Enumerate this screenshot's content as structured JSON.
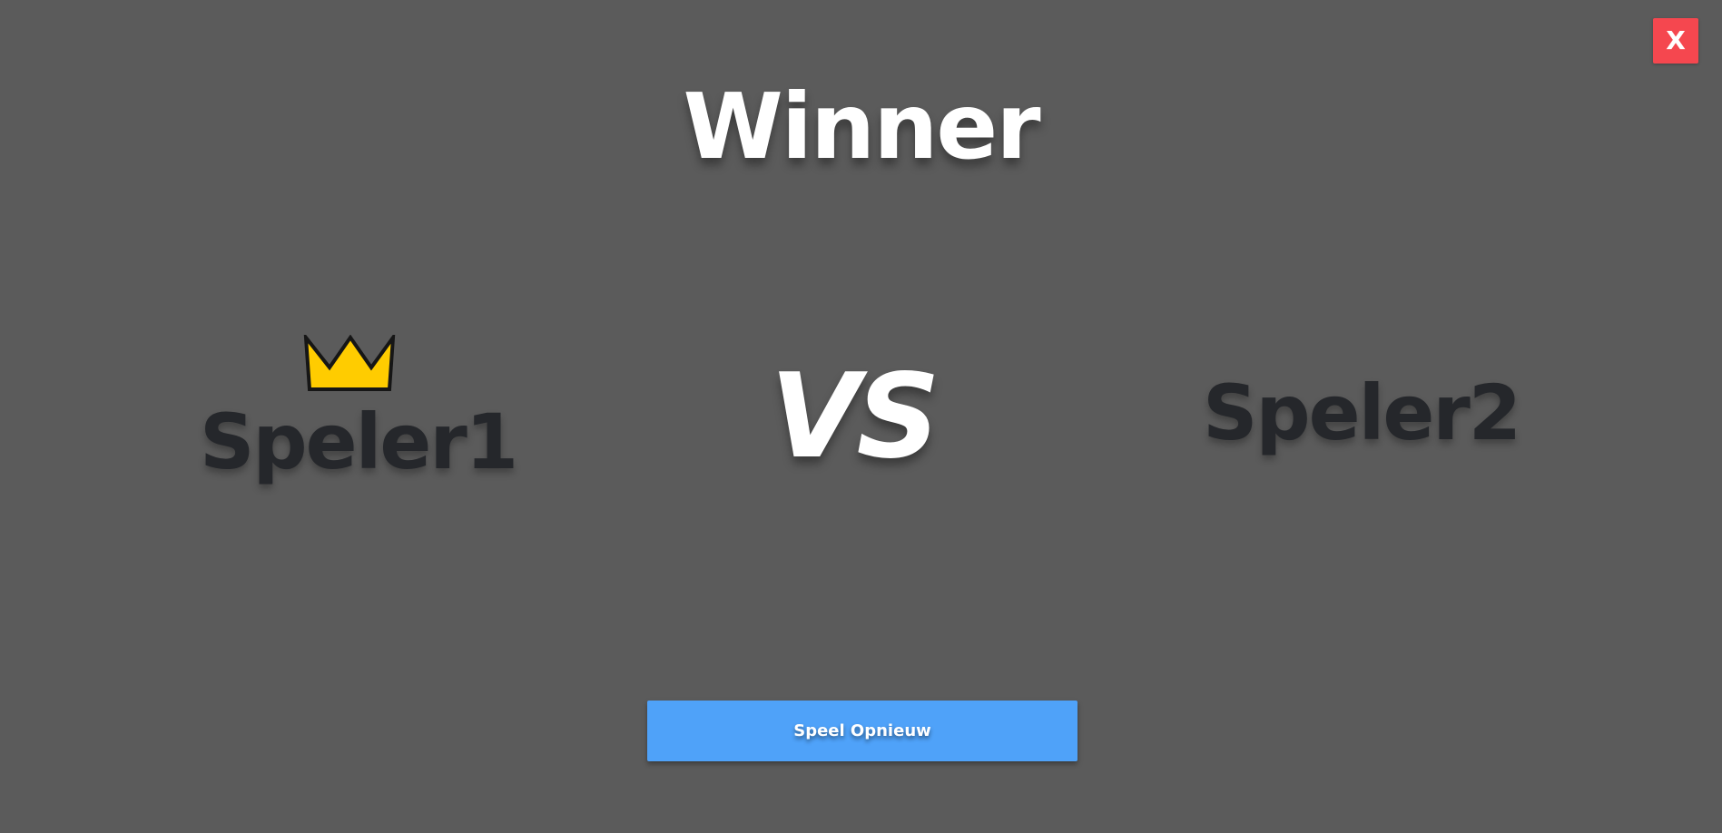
{
  "title": "Winner",
  "close_button": {
    "label": "X",
    "color": "#f5474f"
  },
  "players": [
    {
      "name": "Speler1",
      "is_winner": true,
      "winner_icon": "crown-icon"
    },
    {
      "name": "Speler2",
      "is_winner": false
    }
  ],
  "versus_label": "VS",
  "play_again_button": {
    "label": "Speel Opnieuw",
    "color": "#4fa2f9"
  },
  "colors": {
    "background": "#5b5b5b",
    "player_text": "#25272b",
    "crown": "#ffcc00",
    "title_text": "#ffffff"
  }
}
